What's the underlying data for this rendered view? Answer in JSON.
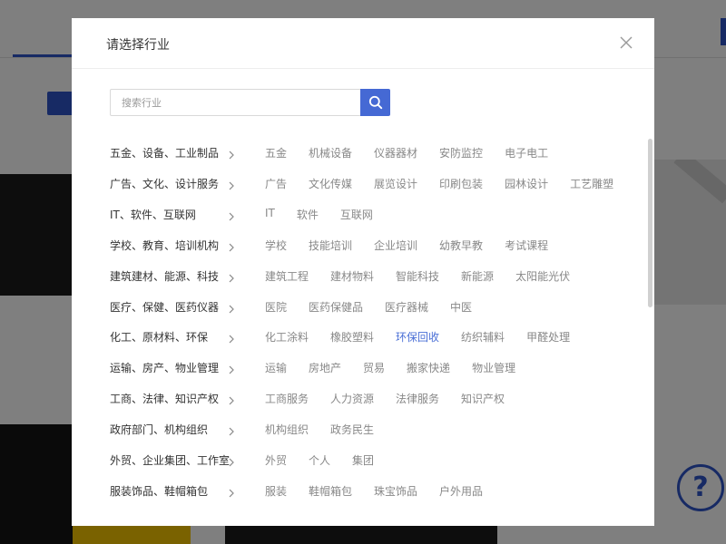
{
  "modal": {
    "title": "请选择行业",
    "search": {
      "placeholder": "搜索行业"
    },
    "rows": [
      {
        "category": "五金、设备、工业制品",
        "items": [
          "五金",
          "机械设备",
          "仪器器材",
          "安防监控",
          "电子电工"
        ]
      },
      {
        "category": "广告、文化、设计服务",
        "items": [
          "广告",
          "文化传媒",
          "展览设计",
          "印刷包装",
          "园林设计",
          "工艺雕塑"
        ]
      },
      {
        "category": "IT、软件、互联网",
        "items": [
          "IT",
          "软件",
          "互联网"
        ]
      },
      {
        "category": "学校、教育、培训机构",
        "items": [
          "学校",
          "技能培训",
          "企业培训",
          "幼教早教",
          "考试课程"
        ]
      },
      {
        "category": "建筑建材、能源、科技",
        "items": [
          "建筑工程",
          "建材物料",
          "智能科技",
          "新能源",
          "太阳能光伏"
        ]
      },
      {
        "category": "医疗、保健、医药仪器",
        "items": [
          "医院",
          "医药保健品",
          "医疗器械",
          "中医"
        ]
      },
      {
        "category": "化工、原材料、环保",
        "items": [
          "化工涂料",
          "橡胶塑料",
          "环保回收",
          "纺织辅料",
          "甲醛处理"
        ]
      },
      {
        "category": "运输、房产、物业管理",
        "items": [
          "运输",
          "房地产",
          "贸易",
          "搬家快递",
          "物业管理"
        ]
      },
      {
        "category": "工商、法律、知识产权",
        "items": [
          "工商服务",
          "人力资源",
          "法律服务",
          "知识产权"
        ]
      },
      {
        "category": "政府部门、机构组织",
        "items": [
          "机构组织",
          "政务民生"
        ]
      },
      {
        "category": "外贸、企业集团、工作室",
        "items": [
          "外贸",
          "个人",
          "集团"
        ]
      },
      {
        "category": "服装饰品、鞋帽箱包",
        "items": [
          "服装",
          "鞋帽箱包",
          "珠宝饰品",
          "户外用品"
        ]
      }
    ],
    "highlighted_item": "环保回收"
  },
  "colors": {
    "accent": "#4569d4",
    "highlight_text": "#4a6fd6",
    "category_text": "#333333",
    "item_text": "#888888"
  },
  "icons": {
    "close": "close-icon",
    "search": "search-icon",
    "chevron": "chevron-right-icon",
    "help": "question-mark-icon"
  },
  "background": {
    "help_glyph": "?"
  }
}
